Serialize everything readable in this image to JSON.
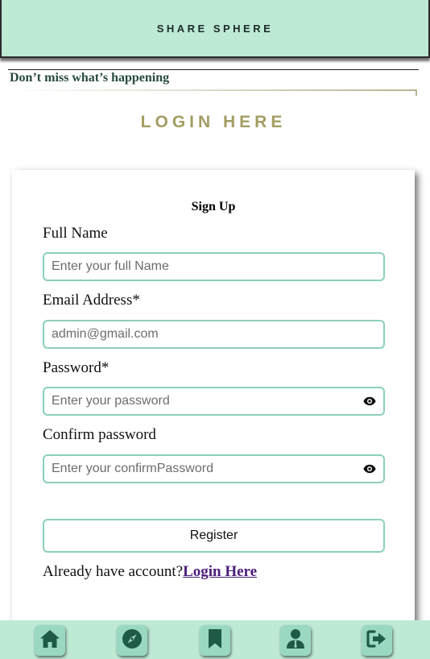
{
  "header": {
    "brand": "SHARE SPHERE"
  },
  "tagline": "Don’t miss what’s happening",
  "login_heading": "LOGIN HERE",
  "form": {
    "title": "Sign Up",
    "full_name": {
      "label": "Full Name",
      "placeholder": "Enter your full Name",
      "value": ""
    },
    "email": {
      "label": "Email Address*",
      "placeholder": "admin@gmail.com",
      "value": ""
    },
    "password": {
      "label": "Password*",
      "placeholder": "Enter your password",
      "value": "",
      "toggle_icon": "eye-icon"
    },
    "confirm_password": {
      "label": "Confirm password",
      "placeholder": "Enter your confirmPassword",
      "value": "",
      "toggle_icon": "eye-icon"
    },
    "register_label": "Register",
    "already_text": "Already have account?",
    "login_link": "Login Here"
  },
  "bottom_nav": {
    "items": [
      {
        "icon": "home-icon"
      },
      {
        "icon": "compass-icon"
      },
      {
        "icon": "bookmark-icon"
      },
      {
        "icon": "user-icon"
      },
      {
        "icon": "logout-icon"
      }
    ]
  },
  "colors": {
    "header_bg": "#bde9d5",
    "accent_border": "#8ccfbd",
    "heading_gold": "#a39d63",
    "nav_icon": "#1f5a47",
    "link": "#4c1d7a"
  }
}
